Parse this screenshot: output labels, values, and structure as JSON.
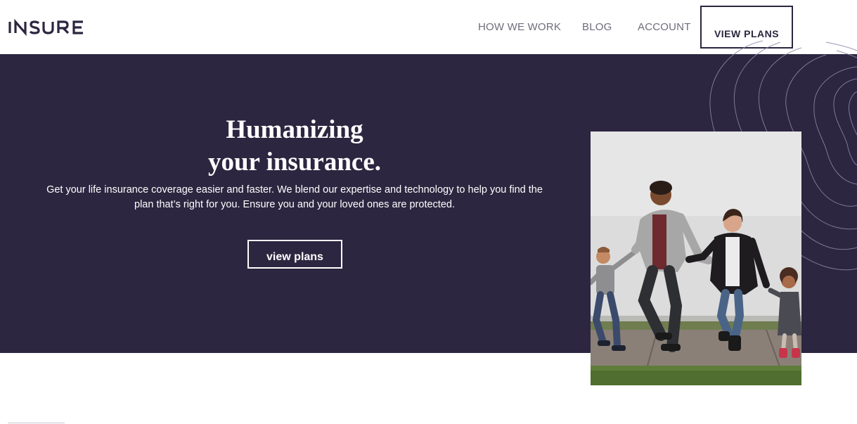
{
  "header": {
    "logo_text": "INSURE",
    "nav": [
      {
        "label": "HOW WE WORK"
      },
      {
        "label": "BLOG"
      },
      {
        "label": "ACCOUNT"
      }
    ],
    "cta_label": "VIEW PLANS"
  },
  "hero": {
    "title_line1": "Humanizing",
    "title_line2": "your insurance.",
    "description": "Get your life insurance coverage easier and faster. We blend our expertise and technology to help you find the plan that’s right for you. Ensure you and your loved ones are protected.",
    "button_label": "view plans",
    "image_description": "family-walking-photo"
  },
  "colors": {
    "brand_dark": "#2c2640",
    "nav_text": "#6f6c7a",
    "white": "#ffffff"
  }
}
